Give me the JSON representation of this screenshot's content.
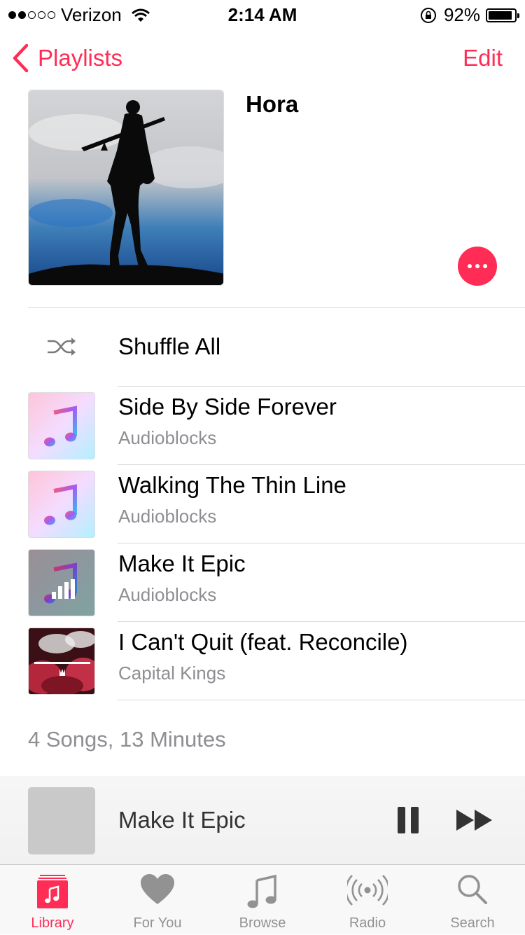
{
  "status_bar": {
    "carrier": "Verizon",
    "time": "2:14 AM",
    "battery": "92%",
    "battery_level": 0.92
  },
  "nav": {
    "back_label": "Playlists",
    "edit_label": "Edit"
  },
  "playlist": {
    "title": "Hora",
    "shuffle_label": "Shuffle All"
  },
  "songs": [
    {
      "title": "Side By Side Forever",
      "artist": "Audioblocks"
    },
    {
      "title": "Walking The Thin Line",
      "artist": "Audioblocks"
    },
    {
      "title": "Make It Epic",
      "artist": "Audioblocks"
    },
    {
      "title": "I Can't Quit (feat. Reconcile)",
      "artist": "Capital Kings"
    }
  ],
  "summary": "4 Songs, 13 Minutes",
  "now_playing": {
    "title": "Make It Epic"
  },
  "tabs": [
    {
      "label": "Library",
      "icon": "library-icon",
      "active": true
    },
    {
      "label": "For You",
      "icon": "heart-icon"
    },
    {
      "label": "Browse",
      "icon": "music-note-icon"
    },
    {
      "label": "Radio",
      "icon": "radio-icon"
    },
    {
      "label": "Search",
      "icon": "search-icon"
    }
  ],
  "colors": {
    "accent": "#ff2d55",
    "secondary_text": "#8e8e93"
  }
}
